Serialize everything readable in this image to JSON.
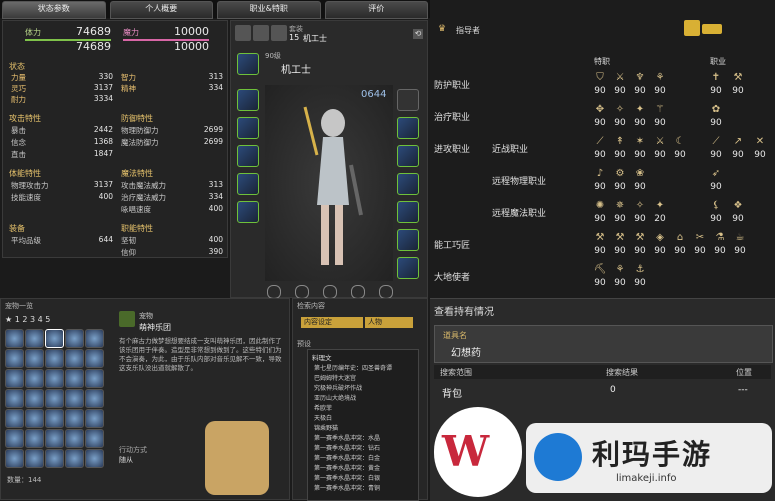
{
  "tabs": [
    "状态参数",
    "个人概要",
    "职业&特职",
    "评价"
  ],
  "status": {
    "hp_label": "体力",
    "hp_val": "74689",
    "hp_max": "74689",
    "mp_label": "魔力",
    "mp_val": "10000",
    "mp_max": "10000",
    "attr_title": "状态",
    "attrs": [
      {
        "k": "力量",
        "v": "330",
        "k2": "智力",
        "v2": "313"
      },
      {
        "k": "灵巧",
        "v": "3137",
        "k2": "精神",
        "v2": "334"
      },
      {
        "k": "耐力",
        "v": "3334",
        "k2": "",
        "v2": ""
      }
    ],
    "atk_title": "攻击特性",
    "def_title": "防御特性",
    "atk": [
      {
        "k": "暴击",
        "v": "2442",
        "k2": "物理防御力",
        "v2": "2699"
      },
      {
        "k": "信念",
        "v": "1368",
        "k2": "魔法防御力",
        "v2": "2699"
      },
      {
        "k": "直击",
        "v": "1847",
        "k2": "",
        "v2": ""
      }
    ],
    "phys_title": "体能特性",
    "magic_title": "魔法特性",
    "phys": [
      {
        "k": "物理攻击力",
        "v": "3137",
        "k2": "攻击魔法威力",
        "v2": "313"
      },
      {
        "k": "技能速度",
        "v": "400",
        "k2": "治疗魔法威力",
        "v2": "334"
      },
      {
        "k": "",
        "v": "",
        "k2": "咏唱速度",
        "v2": "400"
      }
    ],
    "gear_title": "装备",
    "job_trait_title": "职能特性",
    "gear": [
      {
        "k": "平均品级",
        "v": "644",
        "k2": "坚韧",
        "v2": "400"
      },
      {
        "k": "",
        "v": "",
        "k2": "信仰",
        "v2": "390"
      }
    ]
  },
  "character": {
    "job_label": "套装",
    "job_level": "15",
    "job_name": "机工士",
    "level": "90级",
    "job_title": "机工士",
    "item_level": "0644"
  },
  "jobs": {
    "mentor": "指导者",
    "special_header": "特职",
    "job_header": "职业",
    "rows": [
      {
        "name": "防护职业",
        "sub": "",
        "special": [
          "90",
          "90",
          "90",
          "90"
        ],
        "job": [
          "90",
          "90"
        ]
      },
      {
        "name": "治疗职业",
        "sub": "",
        "special": [
          "90",
          "90",
          "90",
          "90"
        ],
        "job": [
          "90"
        ]
      },
      {
        "name": "进攻职业",
        "sub": "近战职业",
        "special": [
          "90",
          "90",
          "90",
          "90",
          "90"
        ],
        "job": [
          "90",
          "90",
          "90"
        ]
      },
      {
        "name": "",
        "sub": "远程物理职业",
        "special": [
          "90",
          "90",
          "90"
        ],
        "job": [
          "90"
        ]
      },
      {
        "name": "",
        "sub": "远程魔法职业",
        "special": [
          "90",
          "90",
          "90",
          "20"
        ],
        "job": [
          "90",
          "90"
        ]
      },
      {
        "name": "能工巧匠",
        "sub": "",
        "special": [
          "90",
          "90",
          "90",
          "90",
          "90",
          "90",
          "90",
          "90"
        ],
        "job": []
      },
      {
        "name": "大地使者",
        "sub": "",
        "special": [
          "90",
          "90",
          "90"
        ],
        "job": []
      }
    ]
  },
  "minion": {
    "title": "宠物一览",
    "category": "宠物",
    "name": "萌神乐团",
    "desc": "有个麻古力做梦想想要结成一支叫萌神乐团，因此制作了该乐团用于伴奏。造型是非常想到做到了。这些特们们为不会演奏，为此，由于乐队内部对音乐见解不一致，导致这支乐队没出道就解散了。",
    "action_label": "行动方式",
    "action_val": "随从",
    "count": "144"
  },
  "search": {
    "title": "检索内容",
    "placeholder": "",
    "tab1": "内容设定",
    "tab2": "人物",
    "section": "预设",
    "list_header": "料理文",
    "items": [
      "第七星历编年史：四圣兽奇谭",
      "巴姆姆特大迷宫",
      "究极神兵破坏作战",
      "亚历山大绝境战",
      "希欧菲",
      "天极白",
      "锦乘野猫",
      "第一赛季水晶冲突：水晶",
      "第一赛季水晶冲突：钻石",
      "第一赛季水晶冲突：白金",
      "第一赛季水晶冲突：黄金",
      "第一赛季水晶冲突：白银",
      "第一赛季水晶冲突：青铜"
    ]
  },
  "inventory": {
    "title": "查看持有情况",
    "item_label": "道具名",
    "item": "幻想药",
    "col1": "搜索范围",
    "col2": "搜索结果",
    "col3": "位置",
    "rows": [
      {
        "a": "背包",
        "b": "0",
        "c": "---"
      }
    ]
  },
  "watermark": {
    "brand": "利玛手游",
    "url": "limakeji.info"
  }
}
